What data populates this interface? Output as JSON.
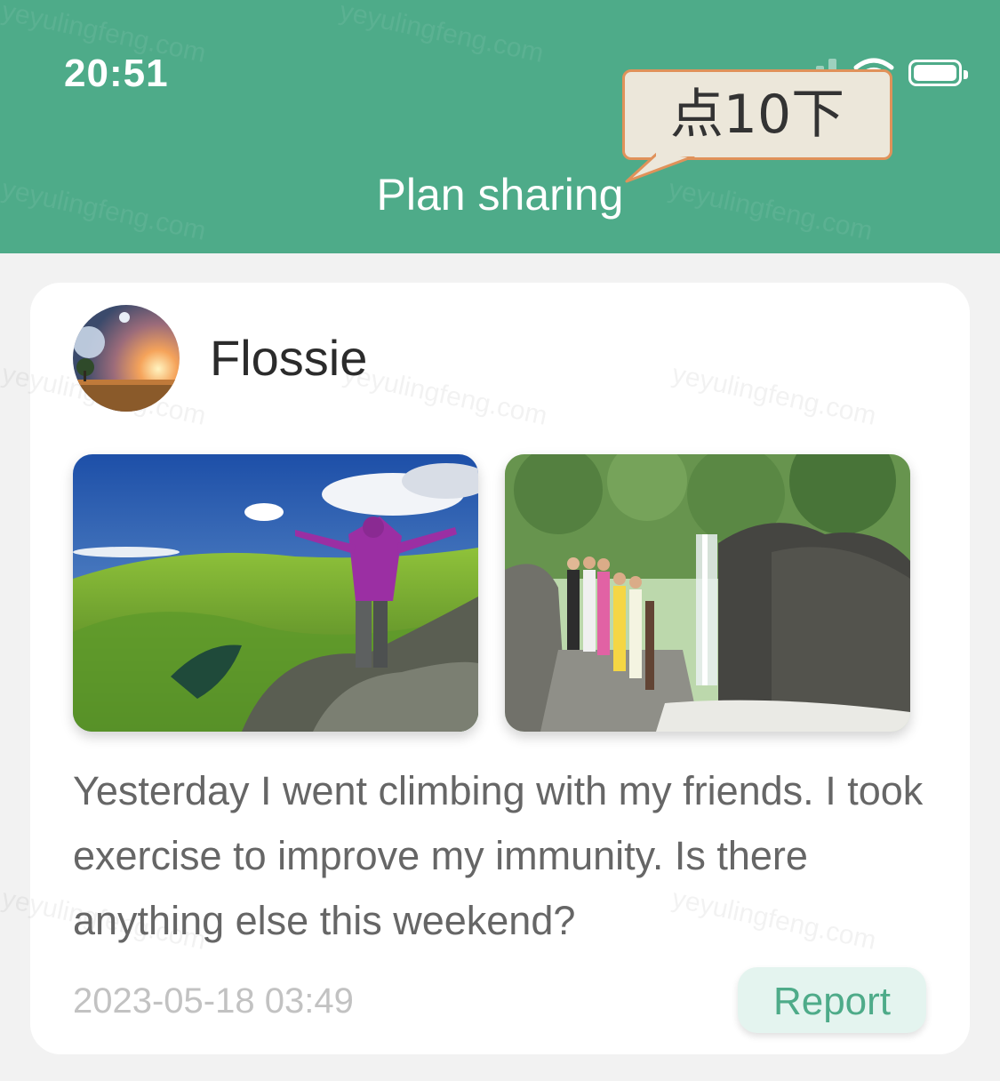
{
  "status_bar": {
    "time": "20:51"
  },
  "header": {
    "title": "Plan sharing"
  },
  "callout": {
    "text": "点10下"
  },
  "post": {
    "username": "Flossie",
    "text": "Yesterday I went climbing with my friends. I took exercise to improve my immunity. Is there anything else this weekend?",
    "timestamp": "2023-05-18 03:49",
    "report_label": "Report"
  },
  "watermark": {
    "text": "yeyulingfeng.com"
  },
  "colors": {
    "accent": "#4eab89",
    "report_bg": "#e4f4ef",
    "callout_border": "#e0925a"
  }
}
